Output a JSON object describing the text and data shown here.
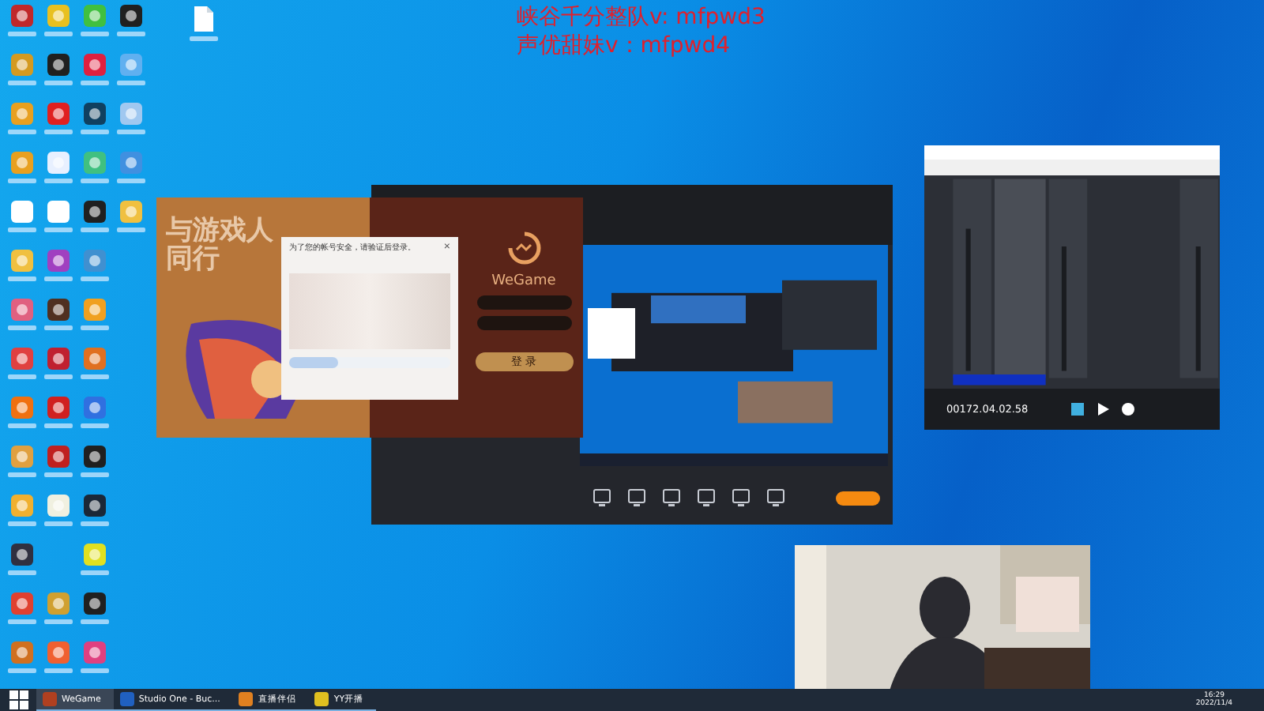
{
  "overlay_text": [
    "峡谷千分整队v: mfpwd3",
    "声优甜妹v：mfpwd4"
  ],
  "wegame_login": {
    "banner_text": "与游戏人同行",
    "logo_text": "WeGame",
    "login_button": "登 录"
  },
  "verify_dialog": {
    "title": "为了您的帐号安全，请验证后登录。",
    "close": "×",
    "slider": {
      "level": 0.3
    }
  },
  "studio_one": {
    "timecode": "00172.04.02.58"
  },
  "taskbar": {
    "items": [
      {
        "label": "WeGame",
        "selected": true
      },
      {
        "label": "Studio One - Buc...",
        "selected": false
      },
      {
        "label": "直播伴侣",
        "selected": false
      },
      {
        "label": "YY开播",
        "selected": false
      }
    ],
    "time": "16:29",
    "date": "2022/11/4"
  }
}
